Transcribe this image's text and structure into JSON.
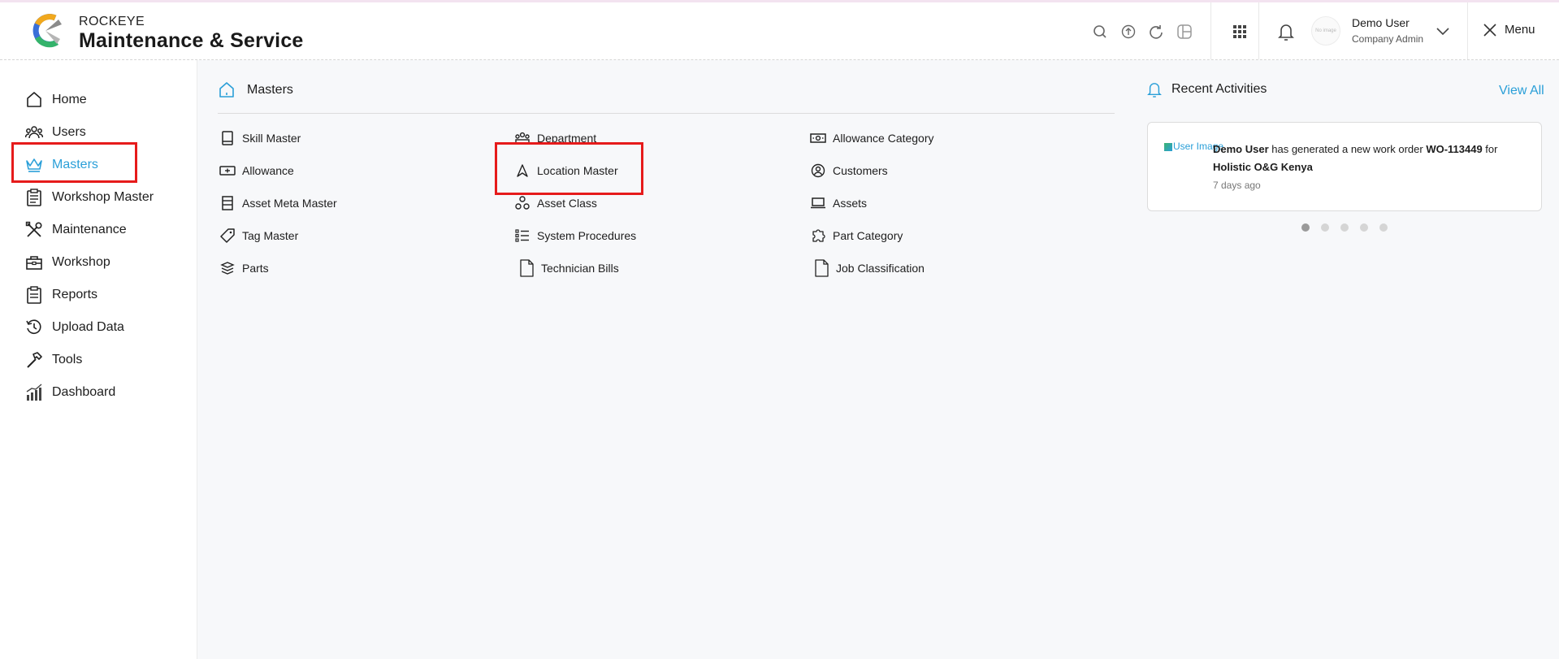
{
  "brand": {
    "small": "ROCKEYE",
    "title": "Maintenance & Service"
  },
  "header": {
    "icons": [
      "search-icon",
      "upload-icon",
      "refresh-icon",
      "layout-icon",
      "apps-grid-icon",
      "bell-icon"
    ],
    "avatar_alt": "No image",
    "user_name": "Demo User",
    "user_role": "Company Admin",
    "menu_label": "Menu"
  },
  "sidebar": {
    "items": [
      {
        "label": "Home",
        "icon": "home-icon"
      },
      {
        "label": "Users",
        "icon": "users-icon"
      },
      {
        "label": "Masters",
        "icon": "crown-icon"
      },
      {
        "label": "Workshop Master",
        "icon": "clipboard-icon"
      },
      {
        "label": "Maintenance",
        "icon": "tools-icon"
      },
      {
        "label": "Workshop",
        "icon": "toolbox-icon"
      },
      {
        "label": "Reports",
        "icon": "report-icon"
      },
      {
        "label": "Upload Data",
        "icon": "history-icon"
      },
      {
        "label": "Tools",
        "icon": "hammer-icon"
      },
      {
        "label": "Dashboard",
        "icon": "chart-icon"
      }
    ]
  },
  "masters": {
    "title": "Masters",
    "col1": [
      {
        "label": "Skill Master",
        "icon": "book-icon"
      },
      {
        "label": "Allowance",
        "icon": "allowance-icon"
      },
      {
        "label": "Asset Meta Master",
        "icon": "list-box-icon"
      },
      {
        "label": "Tag Master",
        "icon": "tag-icon"
      },
      {
        "label": "Parts",
        "icon": "layers-icon"
      }
    ],
    "col2": [
      {
        "label": "Department",
        "icon": "department-icon"
      },
      {
        "label": "Location Master",
        "icon": "navigation-icon"
      },
      {
        "label": "Asset Class",
        "icon": "nodes-icon"
      },
      {
        "label": "System Procedures",
        "icon": "checklist-icon"
      },
      {
        "label": "Technician Bills",
        "icon": "document-icon"
      }
    ],
    "col3": [
      {
        "label": "Allowance Category",
        "icon": "cash-icon"
      },
      {
        "label": "Customers",
        "icon": "user-circle-icon"
      },
      {
        "label": "Assets",
        "icon": "laptop-icon"
      },
      {
        "label": "Part Category",
        "icon": "puzzle-icon"
      },
      {
        "label": "Job Classification",
        "icon": "document-icon"
      }
    ]
  },
  "recent": {
    "title": "Recent Activities",
    "view_all": "View All",
    "card": {
      "img_alt": "User Image",
      "user": "Demo User",
      "middle": " has generated a new work order ",
      "wo": "WO-113449",
      "for": " for ",
      "company": "Holistic O&G Kenya",
      "time": "7 days ago"
    },
    "pages": 5,
    "active_page": 1
  },
  "highlight_color": "#e61b1b",
  "accent_color": "#2a9fd8"
}
